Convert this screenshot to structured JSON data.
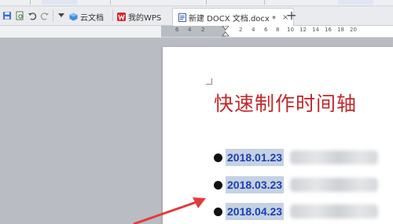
{
  "tabs": [
    {
      "label": "云文档"
    },
    {
      "label": "我的WPS"
    },
    {
      "label": "新建 DOCX 文档.docx *",
      "close": "×"
    }
  ],
  "new_tab_symbol": "+",
  "ruler_numbers": [
    "6",
    "4",
    "2",
    "2",
    "4",
    "6",
    "8",
    "10",
    "12",
    "14",
    "16",
    "18",
    "20"
  ],
  "document": {
    "title": "快速制作时间轴",
    "items": [
      {
        "date": "2018.01.23"
      },
      {
        "date": "2018.03.23"
      },
      {
        "date": "2018.04.23"
      }
    ]
  },
  "colors": {
    "title": "#c0282b",
    "date": "#1b3fb3",
    "arrow": "#e23b3b"
  }
}
